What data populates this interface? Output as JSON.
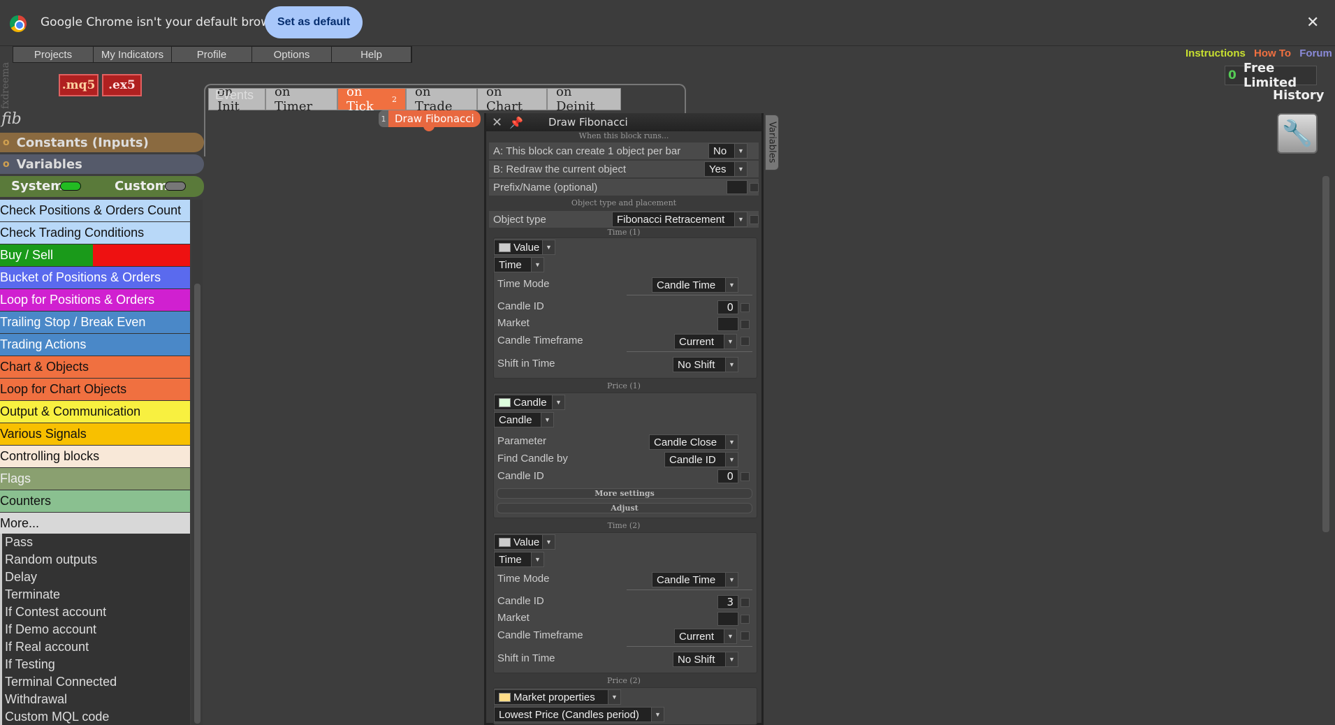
{
  "infobar": {
    "message": "Google Chrome isn't your default browser",
    "set_default": "Set as default",
    "close": "✕"
  },
  "brand_vertical": "fxdreema",
  "menubar": [
    "Projects",
    "My Indicators",
    "Profile",
    "Options",
    "Help"
  ],
  "export": {
    "mq5": ".mq5",
    "ex5": ".ex5"
  },
  "events": {
    "label": "Events",
    "tabs": [
      "on Init",
      "on Timer",
      "on Tick",
      "on Trade",
      "on Chart",
      "on Deinit"
    ],
    "active_tab": "on Tick",
    "active_badge": "2"
  },
  "topright": {
    "instructions": "Instructions",
    "howto": "How To",
    "forum": "Forum",
    "count": "0",
    "plan": "Free Limited",
    "history": "History"
  },
  "sidebar": {
    "search": "fib",
    "constants": "Constants (Inputs)",
    "variables": "Variables",
    "system": "System",
    "custom": "Custom",
    "categories": [
      "Check Positions & Orders Count",
      "Check Trading Conditions",
      "Buy / Sell",
      "Bucket of Positions & Orders",
      "Loop for Positions & Orders",
      "Trailing Stop / Break Even",
      "Trading Actions",
      "Chart & Objects",
      "Loop for Chart Objects",
      "Output & Communication",
      "Various Signals",
      "Controlling blocks",
      "Flags",
      "Counters",
      "More..."
    ],
    "subitems": [
      "Pass",
      "Random outputs",
      "Delay",
      "Terminate",
      "If Contest account",
      "If Demo account",
      "If Real account",
      "If Testing",
      "Terminal Connected",
      "Withdrawal",
      "Custom MQL code"
    ]
  },
  "block": {
    "number": "1",
    "label": "Draw Fibonacci"
  },
  "panel": {
    "title": "Draw Fibonacci",
    "variables_tab": "Variables",
    "when_runs": "When this block runs...",
    "a_label": "A: This block can create 1 object per bar",
    "a_value": "No",
    "b_label": "B: Redraw the current object",
    "b_value": "Yes",
    "prefix_label": "Prefix/Name (optional)",
    "obj_section": "Object type and placement",
    "objtype_label": "Object type",
    "objtype_value": "Fibonacci Retracement",
    "time1": {
      "section": "Time (1)",
      "source": "Value",
      "type": "Time",
      "mode_label": "Time Mode",
      "mode_value": "Candle Time",
      "cid_label": "Candle ID",
      "cid_value": "0",
      "market_label": "Market",
      "tf_label": "Candle Timeframe",
      "tf_value": "Current",
      "shift_label": "Shift in Time",
      "shift_value": "No Shift"
    },
    "price1": {
      "section": "Price (1)",
      "source": "Candle",
      "type": "Candle",
      "param_label": "Parameter",
      "param_value": "Candle Close",
      "find_label": "Find Candle by",
      "find_value": "Candle ID",
      "cid_label": "Candle ID",
      "cid_value": "0",
      "more": "More settings",
      "adjust": "Adjust"
    },
    "time2": {
      "section": "Time (2)",
      "source": "Value",
      "type": "Time",
      "mode_label": "Time Mode",
      "mode_value": "Candle Time",
      "cid_label": "Candle ID",
      "cid_value": "3",
      "market_label": "Market",
      "tf_label": "Candle Timeframe",
      "tf_value": "Current",
      "shift_label": "Shift in Time",
      "shift_value": "No Shift"
    },
    "price2": {
      "section": "Price (2)",
      "source": "Market properties",
      "type": "Lowest Price (Candles period)"
    }
  },
  "colors": {
    "accent": "#f07040",
    "custom_blue": "#a8c7fa"
  }
}
